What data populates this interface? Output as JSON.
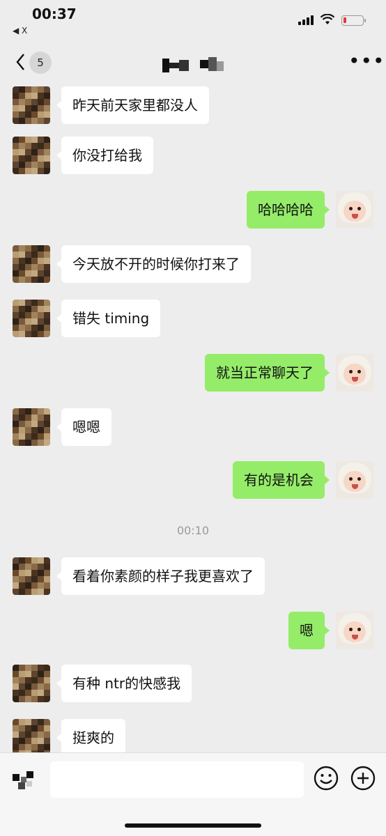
{
  "status_bar": {
    "time": "00:37",
    "back_app": "◀ X"
  },
  "nav": {
    "unread_count": "5",
    "title": "",
    "more": "•••"
  },
  "messages": [
    {
      "from": "them",
      "text": "昨天前天家里都没人"
    },
    {
      "from": "them",
      "text": "你没打给我"
    },
    {
      "from": "me",
      "text": "哈哈哈哈"
    },
    {
      "from": "them",
      "text": "今天放不开的时候你打来了"
    },
    {
      "from": "them",
      "text": "错失 timing"
    },
    {
      "from": "me",
      "text": "就当正常聊天了"
    },
    {
      "from": "them",
      "text": "嗯嗯"
    },
    {
      "from": "me",
      "text": "有的是机会"
    },
    {
      "from": "me",
      "text": "嗯"
    },
    {
      "from": "them",
      "text": "看着你素颜的样子我更喜欢了"
    },
    {
      "from": "them",
      "text": "有种 ntr的快感我"
    },
    {
      "from": "them",
      "text": "挺爽的"
    }
  ],
  "timestamp": "00:10",
  "input": {
    "value": ""
  },
  "colors": {
    "background": "#ededed",
    "my_bubble": "#95ec69",
    "their_bubble": "#ffffff"
  },
  "icons": {
    "voice": "voice-icon",
    "emoji": "emoji-icon",
    "plus": "plus-icon",
    "back": "chevron-left-icon",
    "more": "more-icon"
  }
}
